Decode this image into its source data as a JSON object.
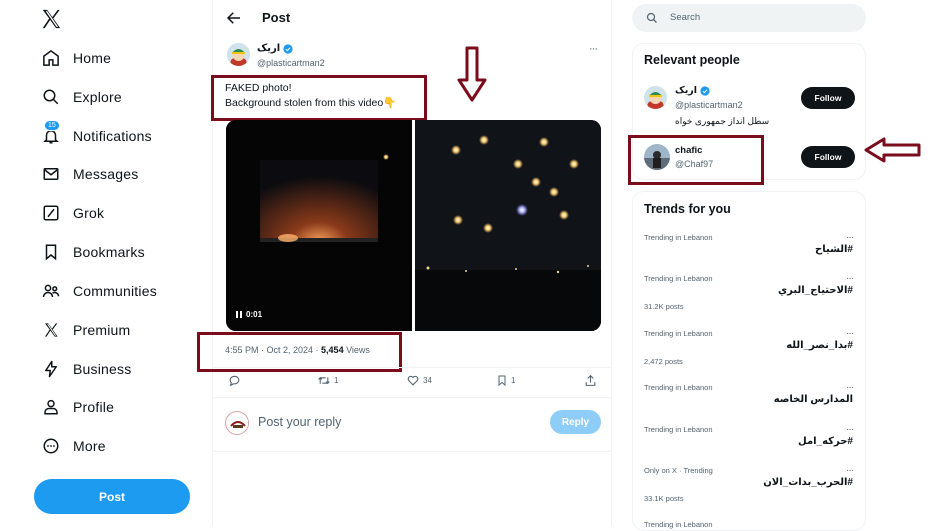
{
  "nav": {
    "items": [
      {
        "label": "Home",
        "icon": "home-icon"
      },
      {
        "label": "Explore",
        "icon": "search-icon"
      },
      {
        "label": "Notifications",
        "icon": "bell-icon",
        "badge": "15"
      },
      {
        "label": "Messages",
        "icon": "envelope-icon"
      },
      {
        "label": "Grok",
        "icon": "grok-icon"
      },
      {
        "label": "Bookmarks",
        "icon": "bookmark-icon"
      },
      {
        "label": "Communities",
        "icon": "people-icon"
      },
      {
        "label": "Premium",
        "icon": "x-logo-icon"
      },
      {
        "label": "Business",
        "icon": "lightning-icon"
      },
      {
        "label": "Profile",
        "icon": "person-icon"
      },
      {
        "label": "More",
        "icon": "more-circle-icon"
      }
    ],
    "post_button": "Post"
  },
  "header": {
    "title": "Post"
  },
  "tweet": {
    "author_name": "اریک",
    "author_handle": "@plasticartman2",
    "text_line1": "FAKED photo!",
    "text_line2": "Background stolen from this video👇",
    "video_time": "0:01",
    "timestamp": "4:55 PM · Oct 2, 2024 · ",
    "views_count": "5,454",
    "views_label": " Views",
    "retweets": "1",
    "likes": "34",
    "bookmarks": "1"
  },
  "reply": {
    "placeholder": "Post your reply",
    "button": "Reply"
  },
  "search": {
    "placeholder": "Search"
  },
  "relevant_people": {
    "title": "Relevant people",
    "people": [
      {
        "name": "اریک",
        "handle": "@plasticartman2",
        "bio": "سطل انداز جمهوری خواه",
        "follow": "Follow"
      },
      {
        "name": "chafic",
        "handle": "@Chaf97",
        "follow": "Follow"
      }
    ]
  },
  "trends": {
    "title": "Trends for you",
    "items": [
      {
        "context": "Trending in Lebanon",
        "name": "#الشياح",
        "count": ""
      },
      {
        "context": "Trending in Lebanon",
        "name": "#الاحتياج_البري",
        "count": "31.2K posts"
      },
      {
        "context": "Trending in Lebanon",
        "name": "#بدا_نصر_الله",
        "count": "2,472 posts"
      },
      {
        "context": "Trending in Lebanon",
        "name": "المدارس الخاصه",
        "count": ""
      },
      {
        "context": "Trending in Lebanon",
        "name": "#حركه_امل",
        "count": ""
      },
      {
        "context": "Only on X · Trending",
        "name": "#الحرب_بدات_الان",
        "count": "33.1K posts"
      },
      {
        "context": "Trending in Lebanon",
        "name": "",
        "count": ""
      }
    ]
  },
  "colors": {
    "accent": "#1d9bf0",
    "annotation": "#7a0c1c",
    "text": "#0f1419",
    "muted": "#536471"
  }
}
